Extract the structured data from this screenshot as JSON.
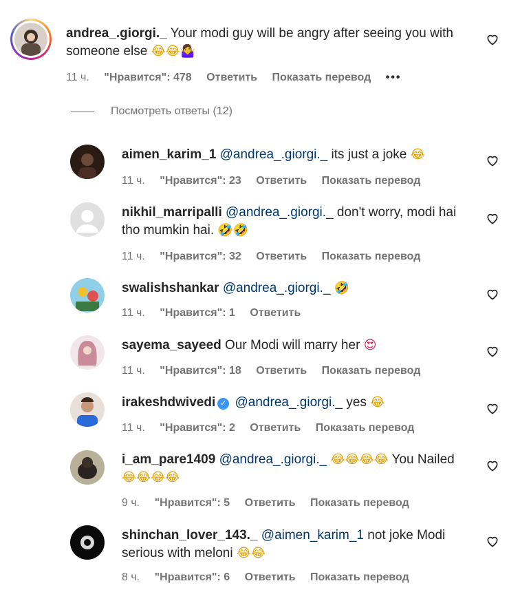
{
  "labels": {
    "likes_prefix": "\"Нравится\": ",
    "reply": "Ответить",
    "translate": "Показать перевод",
    "more": "•••"
  },
  "view_replies": "Посмотреть ответы (12)",
  "colors": {
    "text": "#262626",
    "meta": "#737373",
    "mention": "#00376b",
    "verified": "#3897f0"
  },
  "comments": [
    {
      "username": "andrea_.giorgi._",
      "mention": "",
      "text": "Your modi guy will be angry after seeing you with someone else",
      "emojis": "😂😂🤷‍♀️",
      "time": "11 ч.",
      "likes": "478",
      "avatar_icon": "girl-avatar"
    },
    {
      "username": "aimen_karim_1",
      "mention": "@andrea_.giorgi._",
      "text": "its just a joke",
      "emojis": "😂",
      "time": "11 ч.",
      "likes": "23",
      "avatar_icon": "dark-photo-avatar"
    },
    {
      "username": "nikhil_marripalli",
      "mention": "@andrea_.giorgi._",
      "text": "don't worry, modi hai tho mumkin hai.",
      "emojis": "🤣🤣",
      "time": "11 ч.",
      "likes": "32",
      "avatar_icon": "default-user-avatar"
    },
    {
      "username": "swalishshankar",
      "mention": "@andrea_.giorgi._",
      "text": "",
      "emojis": "🤣",
      "time": "11 ч.",
      "likes": "1",
      "avatar_icon": "cartoon-avatar"
    },
    {
      "username": "sayema_sayeed",
      "mention": "",
      "text": "Our Modi will marry her",
      "emojis": "😍",
      "time": "11 ч.",
      "likes": "18",
      "avatar_icon": "pink-hijab-avatar"
    },
    {
      "username": "irakeshdwivedi",
      "mention": "@andrea_.giorgi._",
      "text": "yes",
      "emojis": "😂",
      "time": "11 ч.",
      "likes": "2",
      "verified": true,
      "avatar_icon": "man-avatar"
    },
    {
      "username": "i_am_pare1409",
      "mention": "@andrea_.giorgi._",
      "text_before": "",
      "emojis_a": "😂😂😂😂",
      "text": "You Nailed",
      "emojis": "😂😂😂😂",
      "time": "9 ч.",
      "likes": "5",
      "avatar_icon": "dog-avatar"
    },
    {
      "username": "shinchan_lover_143._",
      "mention": "@aimen_karim_1",
      "text": "not joke Modi serious with meloni",
      "emojis": "😂😂",
      "time": "8 ч.",
      "likes": "6",
      "avatar_icon": "dark-circle-avatar"
    }
  ]
}
